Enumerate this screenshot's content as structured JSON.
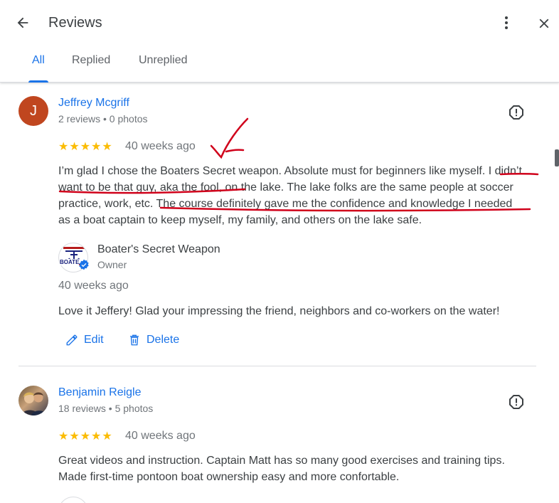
{
  "header": {
    "title": "Reviews",
    "tabs": [
      {
        "label": "All",
        "active": true
      },
      {
        "label": "Replied",
        "active": false
      },
      {
        "label": "Unreplied",
        "active": false
      }
    ]
  },
  "reviews": [
    {
      "avatar_letter": "J",
      "avatar_color": "#c0461f",
      "name": "Jeffrey Mcgriff",
      "meta": "2 reviews • 0 photos",
      "stars": "★★★★★",
      "rating": 5,
      "time": "40 weeks ago",
      "text_lines": [
        "I’m glad I chose the Boaters Secret weapon. Absolute must for beginners like myself. I didn’t",
        "want to be that guy, aka the fool, on the lake. The lake folks are the same people at soccer",
        "practice, work, etc. The course definitely gave me the confidence and knowledge I needed",
        "as a boat captain to keep myself, my family, and others on the lake safe."
      ],
      "reply": {
        "owner_name": "Boater's Secret Weapon",
        "owner_role": "Owner",
        "logo_text": "BOATE",
        "time": "40 weeks ago",
        "text": "Love it Jeffery! Glad your impressing the friend, neighbors and co-workers on the water!",
        "edit_label": "Edit",
        "delete_label": "Delete"
      }
    },
    {
      "name": "Benjamin Reigle",
      "meta": "18 reviews • 5 photos",
      "stars": "★★★★★",
      "rating": 5,
      "time": "40 weeks ago",
      "text_lines": [
        "Great videos and instruction. Captain Matt has so many good exercises and training tips.",
        "Made first-time pontoon boat ownership easy and more confortable."
      ]
    }
  ],
  "colors": {
    "accent": "#1a73e8",
    "star": "#fbbc04",
    "annotation": "#d0021b"
  }
}
